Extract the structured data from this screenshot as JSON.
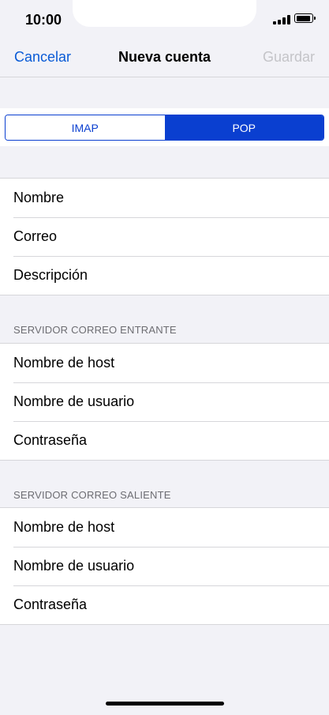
{
  "status": {
    "time": "10:00"
  },
  "nav": {
    "cancel": "Cancelar",
    "title": "Nueva cuenta",
    "save": "Guardar"
  },
  "segmented": {
    "options": [
      "IMAP",
      "POP"
    ],
    "selected": "POP"
  },
  "account": {
    "fields": [
      "Nombre",
      "Correo",
      "Descripción"
    ]
  },
  "incoming": {
    "header": "SERVIDOR CORREO ENTRANTE",
    "fields": [
      "Nombre de host",
      "Nombre de usuario",
      "Contraseña"
    ]
  },
  "outgoing": {
    "header": "SERVIDOR CORREO SALIENTE",
    "fields": [
      "Nombre de host",
      "Nombre de usuario",
      "Contraseña"
    ]
  },
  "colors": {
    "accent": "#0a3fd0",
    "link": "#0a5bd6",
    "disabled": "#c4c4c8",
    "background": "#f2f2f7"
  },
  "icons": [
    "signal-icon",
    "battery-icon"
  ]
}
